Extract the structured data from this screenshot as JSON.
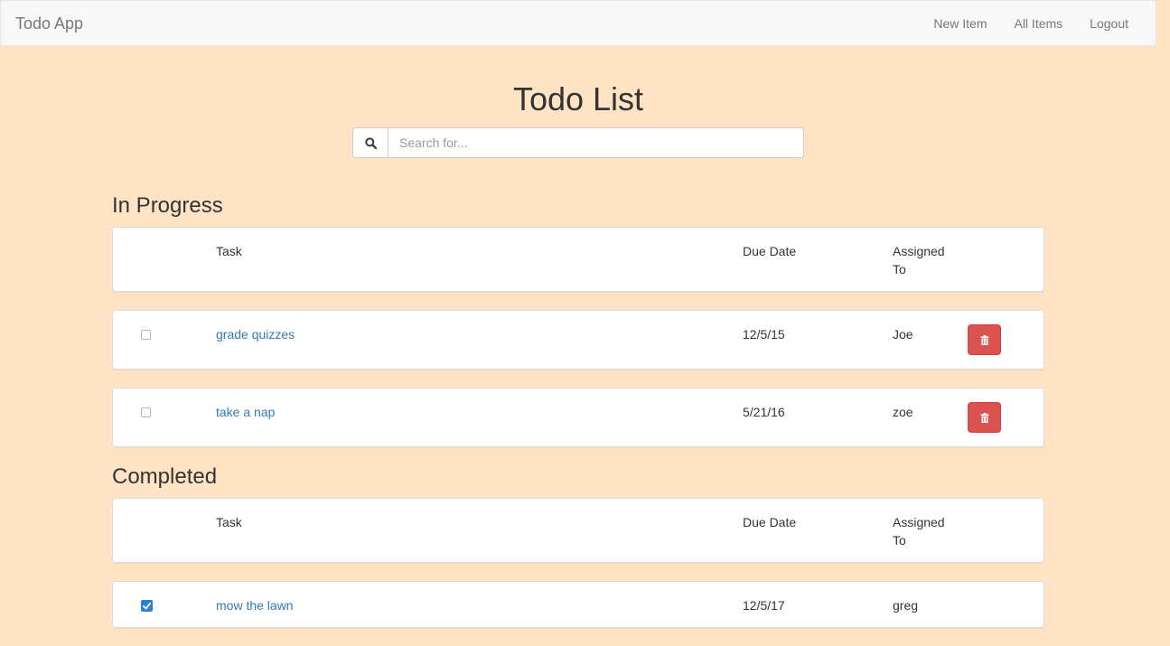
{
  "navbar": {
    "brand": "Todo App",
    "links": [
      "New Item",
      "All Items",
      "Logout"
    ]
  },
  "page_title": "Todo List",
  "search": {
    "placeholder": "Search for..."
  },
  "table_headers": {
    "task": "Task",
    "due_date": "Due Date",
    "assigned_to": "Assigned To"
  },
  "in_progress": {
    "heading": "In Progress",
    "items": [
      {
        "task": "grade quizzes",
        "due": "12/5/15",
        "assigned": "Joe",
        "checked": false
      },
      {
        "task": "take a nap",
        "due": "5/21/16",
        "assigned": "zoe",
        "checked": false
      }
    ]
  },
  "completed": {
    "heading": "Completed",
    "items": [
      {
        "task": "mow the lawn",
        "due": "12/5/17",
        "assigned": "greg",
        "checked": true
      }
    ]
  },
  "colors": {
    "background": "#ffe3c4",
    "link": "#337ab7",
    "danger": "#d9534f",
    "check": "#2f7fd8"
  },
  "icons": [
    "search-icon",
    "trash-icon",
    "check-icon"
  ]
}
